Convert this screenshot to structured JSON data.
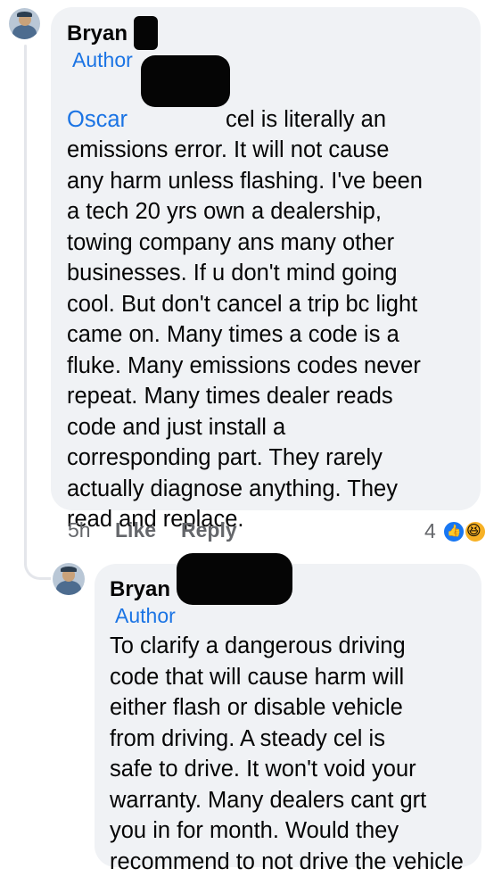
{
  "comment1": {
    "author_name": "Bryan T",
    "author_badge": "Author",
    "mention": "Oscar",
    "body_line1_tail": "cel is literally an",
    "body_rest": "emissions error. It will not cause\nany harm unless flashing. I've been\na tech 20 yrs own a dealership,\ntowing company ans many other\nbusinesses. If u don't mind going\ncool. But don't cancel a trip bc light\ncame on. Many times a code is a\nfluke. Many emissions codes never\nrepeat. Many times dealer reads\ncode and just install a\ncorresponding part. They rarely\nactually diagnose anything. They\nread and replace.",
    "time": "5h",
    "like_label": "Like",
    "reply_label": "Reply",
    "reaction_count": "4",
    "reaction_icons": [
      "like-icon",
      "haha-icon"
    ]
  },
  "comment2": {
    "author_name": "Bryan T",
    "author_badge": "Author",
    "body": "To clarify a dangerous driving\ncode that will cause harm will\neither flash or disable vehicle\nfrom driving. A steady cel is\nsafe to drive. It won't void your\nwarranty. Many dealers cant grt\nyou in for month. Would they\nrecommend to not drive the vehicle"
  },
  "colors": {
    "bubble": "#f0f2f5",
    "link": "#1b74e4",
    "meta": "#65676b",
    "redaction": "#050505"
  }
}
